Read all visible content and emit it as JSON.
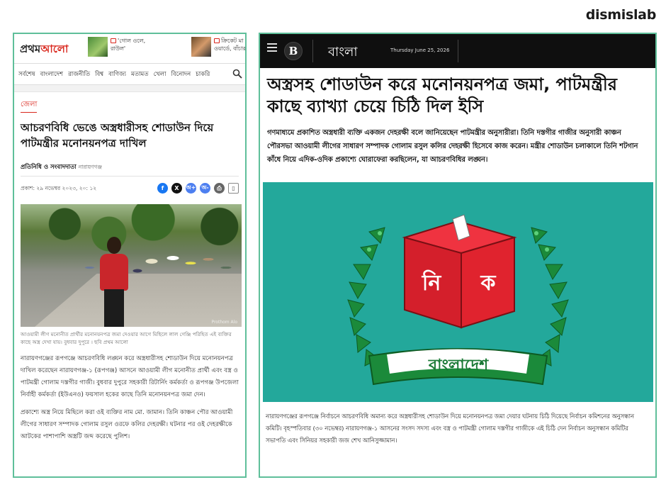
{
  "brand": "dismislab",
  "left": {
    "logo": {
      "main": "প্রথম",
      "accent": "আলো"
    },
    "promos": [
      {
        "text": "'গোল ওলে, রাউল'"
      },
      {
        "text": "ক্রিকেট মা ওয়ার্ডে, বাঁচার"
      }
    ],
    "nav": [
      "সর্বশেষ",
      "বাংলাদেশ",
      "রাজনীতি",
      "বিশ্ব",
      "বাণিজ্য",
      "মতামত",
      "খেলা",
      "বিনোদন",
      "চাকরি"
    ],
    "category": "জেলা",
    "title": "আচরণবিধি ভেঙে অস্ত্রধারীসহ শোডাউন দিয়ে পাটমন্ত্রীর মনোনয়নপত্র দাখিল",
    "author": "প্রতিনিধি ও সংবাদদাতা",
    "author_location": "নারায়ণগঞ্জ",
    "published": "প্রকাশ: ২৯ নভেম্বর ২০২৩, ২০: ১২",
    "share": {
      "facebook": "f",
      "x": "X",
      "bn1": "অ+",
      "bn2": "অ-"
    },
    "photo_watermark": "Prothom Alo",
    "caption": "আওয়ামী লীগ মনোনীত প্রার্থীর মনোনয়নপত্র জমা দেওয়ার আগে মিছিলে লাল গেঞ্জি পরিহিত এই ব্যক্তির কাছে অস্ত্র দেখা যায়। বুধবার দুপুরে । ছবি প্রথম আলো",
    "para1": "নারায়ণগঞ্জের রূপগঞ্জে আচরণবিধি লঙ্ঘন করে অস্ত্রধারীসহ শোডাউন দিয়ে মনোনয়নপত্র দাখিল করেছেন নারায়ণগঞ্জ-১ (রূপগঞ্জ) আসনে আওয়ামী লীগ মনোনীত প্রার্থী এবং বস্ত্র ও পাটমন্ত্রী গোলাম দস্তগীর গাজী। বুধবার দুপুরে সহকারী রিটার্নিং কর্মকর্তা ও রূপগঞ্জ উপজেলা নির্বাহী কর্মকর্তা (ইউএনও) ফয়সাল হকের কাছে তিনি মনোনয়নপত্র জমা দেন।",
    "para2": "প্রকাশ্যে অস্ত্র নিয়ে মিছিলে করা ওই ব্যক্তির নাম মো. জামান। তিনি কাঞ্চন পৌর আওয়ামী লীগের সাধারণ সম্পাদক গোলাম রসুল ওরফে কলির দেহরক্ষী। ঘটনার পর ওই দেহরক্ষীকে আটকের পাশাপাশি অস্ত্রটি জব্দ করেছে পুলিশ।"
  },
  "right": {
    "logo_letter": "B",
    "language": "বাংলা",
    "date": "Thursday June 25, 2026",
    "title": "অস্ত্রসহ শোডাউন করে মনোনয়নপত্র জমা, পাটমন্ত্রীর কাছে ব্যাখ্যা চেয়ে চিঠি দিল ইসি",
    "lead": "গণমাধ্যমে প্রকাশিত অস্ত্রধারী ব্যক্তি একজন দেহরক্ষী বলে জানিয়েছেন পাটমন্ত্রীর অনুসারীরা। তিনি দস্তগীর গাজীর অনুসারী কাঞ্চন পৌরসভা আওয়ামী লীগের সাধারণ সম্পাদক গোলাম রসুল কলির দেহরক্ষী হিসেবে কাজ করেন। মন্ত্রীর শোডাউন চলাকালে তিনি শটগান কাঁধে নিয়ে এদিক-ওদিক প্রকাশ্যে ঘোরাফেরা করছিলেন, যা আচরণবিধির লঙ্ঘন।",
    "logo_box_letters": [
      "নি",
      "ক"
    ],
    "logo_ribbon": "বাংলাদেশ",
    "footer": "নারায়ণগঞ্জের রূপগঞ্জে নির্বাচনে আচরণবিধি অমান্য করে অস্ত্রধারীসহ শোডাউন দিয়ে মনোনয়নপত্র জমা দেয়ার ঘটনায় চিঠি দিয়েছে নির্বাচন কমিশনের অনুসন্ধান কমিটি। বৃহস্পতিবার (৩০ নভেম্বর) নারায়ণগঞ্জ-১ আসনের সংসদ সদস্য এবং বস্ত্র ও পাটমন্ত্রী গোলাম দস্তগীর গাজীকে এই চিঠি দেন নির্বাচন অনুসন্ধান কমিটির সভাপতি এবং সিনিয়র সহকারী জজ শেখ আনিসুজ্জামান।"
  },
  "colors": {
    "panel_border": "#5fbf9a",
    "prothom_red": "#d9261c",
    "ec_teal": "#23a89b",
    "ec_green": "#1b8a3a",
    "ballot_red": "#e0232e"
  }
}
